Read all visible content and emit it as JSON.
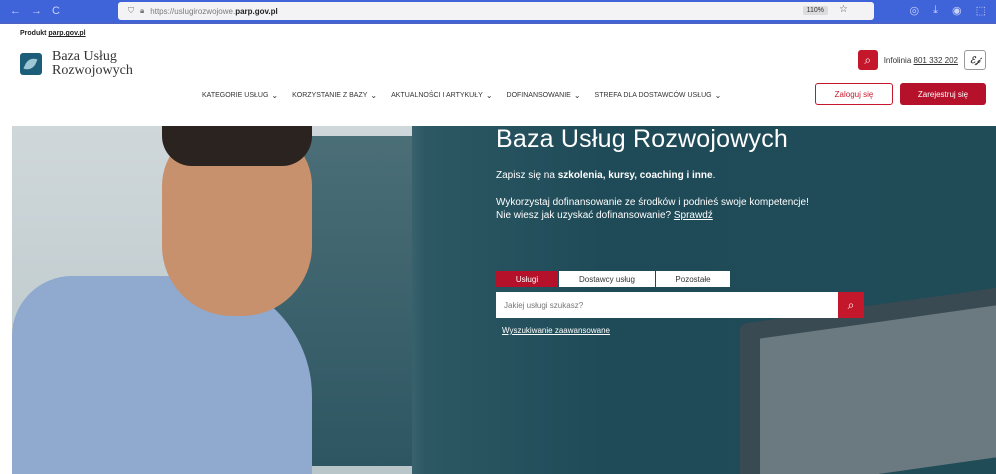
{
  "browser": {
    "back": "←",
    "forward": "→",
    "reload": "C",
    "url_prefix": "https://uslugirozwojowe.",
    "url_host": "parp.gov.pl",
    "zoom": "110%",
    "star": "☆"
  },
  "header": {
    "produkt_label": "Produkt",
    "produkt_link": "parp.gov.pl",
    "logo_line1": "Baza Usług",
    "logo_line2": "Rozwojowych",
    "infolinia_label": "Infolinia",
    "infolinia_number": "801 332 202",
    "sign_icon_text": "ℰ𝒿"
  },
  "nav": {
    "items": [
      {
        "label": "KATEGORIE USŁUG"
      },
      {
        "label": "KORZYSTANIE Z BAZY"
      },
      {
        "label": "AKTUALNOŚCI I ARTYKUŁY"
      },
      {
        "label": "DOFINANSOWANIE"
      },
      {
        "label": "STREFA DLA DOSTAWCÓW USŁUG"
      }
    ],
    "login": "Zaloguj się",
    "register": "Zarejestruj się"
  },
  "hero": {
    "title": "Baza Usług Rozwojowych",
    "sub1_pre": "Zapisz się na ",
    "sub1_bold": "szkolenia, kursy, coaching i inne",
    "sub1_post": ".",
    "sub2_line1": "Wykorzystaj dofinansowanie ze środków i podnieś swoje kompetencje!",
    "sub2_line2_pre": "Nie wiesz jak uzyskać dofinansowanie? ",
    "sub2_link": "Sprawdź",
    "tabs": [
      "Usługi",
      "Dostawcy usług",
      "Pozostałe"
    ],
    "search_placeholder": "Jakiej usługi szukasz?",
    "advanced_search": "Wyszukiwanie zaawansowane"
  },
  "colors": {
    "brand_red": "#b5112a",
    "browser_blue": "#3f63d8",
    "hero_teal": "#1f4a57"
  }
}
